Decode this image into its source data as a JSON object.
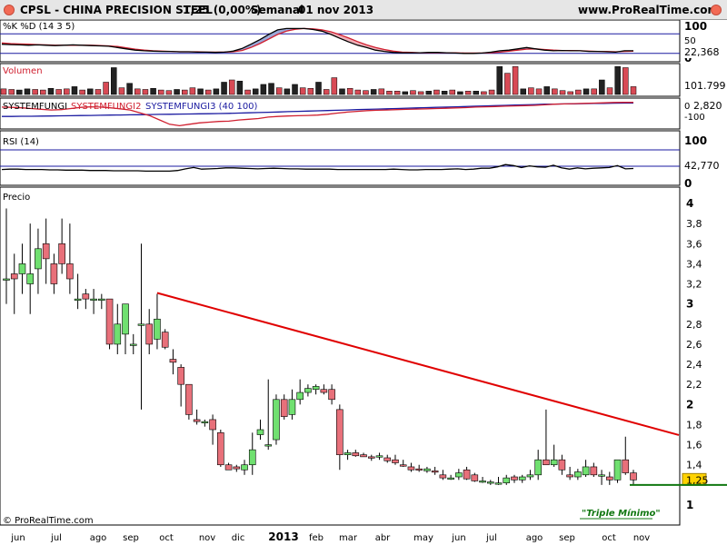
{
  "header": {
    "instrument": "CPSL - CHINA PRECISION STEEL",
    "last_quote": "1,25 (0,00%)",
    "period": "Semanal",
    "date": "01 nov 2013",
    "site": "www.ProRealTime.com"
  },
  "footer": {
    "copyright": "© ProRealTime.com"
  },
  "colors": {
    "red": "#e00000",
    "green": "#00aa00",
    "blue": "#1a1aa0",
    "bar_red": "#e8707a",
    "bar_green": "#70e070"
  },
  "chart_data": [
    {
      "type": "line",
      "title": "%K %D (14 3 5)",
      "ylim": [
        0,
        100
      ],
      "tick_labels": [
        "100",
        "50",
        "0"
      ],
      "last_value_label": "22,368",
      "series": [
        {
          "name": "%K",
          "values": [
            48,
            47,
            46,
            45,
            46,
            45,
            44,
            45,
            46,
            45,
            44,
            43,
            42,
            38,
            34,
            30,
            28,
            27,
            26,
            26,
            25,
            25,
            24,
            24,
            23,
            24,
            27,
            35,
            48,
            62,
            78,
            92,
            96,
            96,
            96,
            93,
            88,
            78,
            66,
            55,
            45,
            38,
            30,
            26,
            23,
            22,
            22,
            22,
            23,
            23,
            22,
            21,
            20,
            20,
            21,
            24,
            28,
            30,
            34,
            38,
            34,
            30,
            28,
            29,
            28,
            28,
            26,
            26,
            25,
            24,
            28,
            28
          ]
        },
        {
          "name": "%D",
          "values": [
            52,
            50,
            49,
            48,
            47,
            46,
            45,
            45,
            45,
            45,
            45,
            44,
            43,
            41,
            37,
            33,
            30,
            28,
            27,
            26,
            25,
            25,
            25,
            24,
            24,
            24,
            25,
            29,
            38,
            50,
            64,
            78,
            88,
            94,
            96,
            95,
            92,
            86,
            77,
            67,
            56,
            46,
            38,
            32,
            27,
            24,
            23,
            22,
            22,
            22,
            22,
            22,
            21,
            21,
            21,
            22,
            24,
            27,
            30,
            33,
            34,
            32,
            30,
            29,
            29,
            28,
            27,
            26,
            26,
            25,
            26,
            27
          ]
        }
      ]
    },
    {
      "type": "bar",
      "title": "Volumen",
      "last_value_label": "101.799",
      "values": [
        10,
        9,
        8,
        10,
        9,
        8,
        11,
        9,
        10,
        14,
        8,
        10,
        9,
        22,
        48,
        12,
        20,
        10,
        9,
        11,
        8,
        7,
        9,
        8,
        12,
        10,
        8,
        10,
        22,
        26,
        24,
        8,
        10,
        18,
        20,
        12,
        10,
        18,
        12,
        11,
        22,
        9,
        30,
        10,
        11,
        8,
        7,
        9,
        10,
        6,
        6,
        5,
        7,
        5,
        6,
        8,
        6,
        8,
        5,
        6,
        6,
        5,
        8,
        50,
        38,
        50,
        10,
        12,
        10,
        14,
        10,
        7,
        5,
        8,
        10,
        10,
        26,
        12,
        50,
        48,
        14
      ],
      "up": [
        false,
        false,
        true,
        true,
        false,
        false,
        true,
        false,
        false,
        true,
        false,
        true,
        false,
        false,
        true,
        false,
        true,
        false,
        false,
        true,
        false,
        false,
        true,
        false,
        false,
        true,
        false,
        true,
        true,
        false,
        true,
        false,
        true,
        true,
        true,
        false,
        true,
        true,
        false,
        false,
        true,
        false,
        false,
        true,
        false,
        false,
        false,
        true,
        false,
        false,
        false,
        true,
        false,
        false,
        true,
        false,
        true,
        false,
        true,
        false,
        true,
        false,
        false,
        true,
        false,
        false,
        true,
        false,
        false,
        true,
        false,
        false,
        false,
        false,
        true,
        false,
        true,
        false,
        true,
        false,
        false
      ]
    },
    {
      "type": "line",
      "title": "SYSTEMFUNGI SYSTEMFUNGI2 SYSTEMFUNGI3 (40 100)",
      "legend": [
        "SYSTEMFUNGI",
        "SYSTEMFUNGI2",
        "SYSTEMFUNGI3 (40 100)"
      ],
      "tick_labels": [
        "0",
        "-100"
      ],
      "last_value_label": "2,820",
      "series": [
        {
          "name": "SYSTEMFUNGI2",
          "values": [
            -30,
            -32,
            -35,
            -40,
            -45,
            -50,
            -48,
            -40,
            -32,
            -28,
            -30,
            -35,
            -42,
            -50,
            -70,
            -90,
            -120,
            -150,
            -160,
            -150,
            -140,
            -135,
            -130,
            -128,
            -120,
            -115,
            -110,
            -100,
            -95,
            -92,
            -90,
            -88,
            -86,
            -80,
            -72,
            -65,
            -60,
            -55,
            -52,
            -50,
            -48,
            -46,
            -44,
            -42,
            -40,
            -38,
            -36,
            -34,
            -30,
            -28,
            -26,
            -24,
            -22,
            -20,
            -18,
            -14,
            -10,
            -8,
            -6,
            -4,
            -2,
            0,
            2,
            3,
            3
          ]
        },
        {
          "name": "SYSTEMFUNGI3",
          "values": [
            -95,
            -95,
            -94,
            -94,
            -93,
            -92,
            -91,
            -90,
            -89,
            -88,
            -87,
            -86,
            -85,
            -84,
            -83,
            -82,
            -81,
            -80,
            -79,
            -78,
            -77,
            -76,
            -75,
            -74,
            -72,
            -70,
            -68,
            -66,
            -64,
            -62,
            -60,
            -58,
            -56,
            -54,
            -52,
            -50,
            -48,
            -46,
            -44,
            -42,
            -40,
            -38,
            -36,
            -34,
            -32,
            -30,
            -28,
            -26,
            -24,
            -22,
            -20,
            -18,
            -16,
            -14,
            -12,
            -10,
            -9,
            -8,
            -7,
            -6,
            -5,
            -4,
            -3,
            -2,
            -2
          ]
        }
      ]
    },
    {
      "type": "line",
      "title": "RSI (14)",
      "ylim": [
        0,
        100
      ],
      "tick_labels": [
        "100",
        "0"
      ],
      "last_value_label": "42,770",
      "series": [
        {
          "name": "RSI",
          "values": [
            40,
            41,
            41,
            40,
            40,
            40,
            39,
            39,
            38,
            38,
            38,
            37,
            37,
            37,
            36,
            36,
            36,
            36,
            35,
            35,
            35,
            35,
            37,
            42,
            46,
            41,
            42,
            43,
            45,
            45,
            44,
            43,
            42,
            43,
            44,
            43,
            42,
            42,
            41,
            41,
            41,
            41,
            40,
            40,
            40,
            40,
            40,
            40,
            40,
            41,
            40,
            39,
            39,
            40,
            40,
            40,
            41,
            42,
            40,
            41,
            44,
            44,
            48,
            55,
            52,
            46,
            51,
            48,
            47,
            53,
            45,
            41,
            45,
            42,
            44,
            45,
            46,
            52,
            42,
            43
          ]
        }
      ]
    },
    {
      "type": "candlestick",
      "title": "Precio",
      "ylim": [
        1,
        4
      ],
      "y_ticks": [
        4,
        3.8,
        3.6,
        3.4,
        3.2,
        3,
        2.8,
        2.6,
        2.4,
        2.2,
        2,
        1.8,
        1.6,
        1.4,
        1.25,
        1
      ],
      "y_tick_labels": [
        "4",
        "3,8",
        "3,6",
        "3,4",
        "3,2",
        "3",
        "2,8",
        "2,6",
        "2,4",
        "2,2",
        "2",
        "1,8",
        "1,6",
        "1,4",
        "1,25",
        "1"
      ],
      "bold_ticks": [
        "4",
        "3",
        "2",
        "1"
      ],
      "x_labels": [
        "jun",
        "jul",
        "ago",
        "sep",
        "oct",
        "nov",
        "dic",
        "2013",
        "feb",
        "mar",
        "abr",
        "may",
        "jun",
        "jul",
        "ago",
        "sep",
        "oct",
        "nov"
      ],
      "last_price_label": "1,25",
      "annotation": "\"Triple Mínimo\"",
      "trendline": {
        "from": [
          19,
          3.11
        ],
        "to": [
          92,
          1.54
        ]
      },
      "support_line": {
        "value": 1.2,
        "from": 79,
        "to": 89
      },
      "candles": [
        [
          3.25,
          3.95,
          3.0,
          3.25
        ],
        [
          3.3,
          3.5,
          2.9,
          3.25
        ],
        [
          3.3,
          3.6,
          3.1,
          3.4
        ],
        [
          3.2,
          3.8,
          2.9,
          3.3
        ],
        [
          3.35,
          3.75,
          3.1,
          3.55
        ],
        [
          3.6,
          3.85,
          3.2,
          3.45
        ],
        [
          3.4,
          3.5,
          3.1,
          3.2
        ],
        [
          3.6,
          3.85,
          3.3,
          3.4
        ],
        [
          3.4,
          3.8,
          3.1,
          3.25
        ],
        [
          3.05,
          3.3,
          2.95,
          3.05
        ],
        [
          3.1,
          3.15,
          2.95,
          3.05
        ],
        [
          3.05,
          3.15,
          2.9,
          3.05
        ],
        [
          3.05,
          3.1,
          2.95,
          3.05
        ],
        [
          3.05,
          3.05,
          2.55,
          2.6
        ],
        [
          2.6,
          3.0,
          2.5,
          2.8
        ],
        [
          2.7,
          3.0,
          2.5,
          3.0
        ],
        [
          2.6,
          2.7,
          2.5,
          2.6
        ],
        [
          2.8,
          3.6,
          1.95,
          2.8
        ],
        [
          2.8,
          2.95,
          2.5,
          2.6
        ],
        [
          2.65,
          3.1,
          2.55,
          2.85
        ],
        [
          2.72,
          2.75,
          2.55,
          2.57
        ],
        [
          2.45,
          2.55,
          2.3,
          2.42
        ],
        [
          2.37,
          2.4,
          1.98,
          2.2
        ],
        [
          2.2,
          2.2,
          1.85,
          1.9
        ],
        [
          1.85,
          1.95,
          1.8,
          1.83
        ],
        [
          1.83,
          1.85,
          1.78,
          1.83
        ],
        [
          1.85,
          1.9,
          1.6,
          1.75
        ],
        [
          1.72,
          1.75,
          1.38,
          1.4
        ],
        [
          1.4,
          1.42,
          1.35,
          1.35
        ],
        [
          1.38,
          1.4,
          1.33,
          1.36
        ],
        [
          1.35,
          1.45,
          1.3,
          1.4
        ],
        [
          1.4,
          1.72,
          1.3,
          1.55
        ],
        [
          1.7,
          1.85,
          1.65,
          1.75
        ],
        [
          1.6,
          2.25,
          1.55,
          1.6
        ],
        [
          1.65,
          2.1,
          1.6,
          2.05
        ],
        [
          2.05,
          2.1,
          1.85,
          1.88
        ],
        [
          1.9,
          2.15,
          1.85,
          2.05
        ],
        [
          2.05,
          2.25,
          2.0,
          2.12
        ],
        [
          2.12,
          2.2,
          2.08,
          2.16
        ],
        [
          2.15,
          2.2,
          2.1,
          2.18
        ],
        [
          2.15,
          2.2,
          2.1,
          2.12
        ],
        [
          2.15,
          2.2,
          2.0,
          2.05
        ],
        [
          1.95,
          2.0,
          1.35,
          1.5
        ],
        [
          1.5,
          1.55,
          1.45,
          1.52
        ],
        [
          1.52,
          1.55,
          1.48,
          1.49
        ],
        [
          1.5,
          1.52,
          1.48,
          1.48
        ],
        [
          1.48,
          1.5,
          1.44,
          1.47
        ],
        [
          1.48,
          1.52,
          1.45,
          1.49
        ],
        [
          1.47,
          1.5,
          1.42,
          1.44
        ],
        [
          1.45,
          1.5,
          1.4,
          1.42
        ],
        [
          1.4,
          1.45,
          1.38,
          1.39
        ],
        [
          1.38,
          1.42,
          1.33,
          1.35
        ],
        [
          1.36,
          1.4,
          1.33,
          1.35
        ],
        [
          1.34,
          1.38,
          1.32,
          1.36
        ],
        [
          1.34,
          1.38,
          1.3,
          1.33
        ],
        [
          1.3,
          1.35,
          1.25,
          1.27
        ],
        [
          1.27,
          1.3,
          1.25,
          1.27
        ],
        [
          1.28,
          1.36,
          1.25,
          1.32
        ],
        [
          1.35,
          1.38,
          1.25,
          1.26
        ],
        [
          1.3,
          1.32,
          1.23,
          1.24
        ],
        [
          1.24,
          1.28,
          1.22,
          1.24
        ],
        [
          1.22,
          1.25,
          1.2,
          1.23
        ],
        [
          1.22,
          1.28,
          1.2,
          1.22
        ],
        [
          1.22,
          1.3,
          1.2,
          1.27
        ],
        [
          1.28,
          1.3,
          1.22,
          1.25
        ],
        [
          1.25,
          1.3,
          1.22,
          1.28
        ],
        [
          1.28,
          1.35,
          1.25,
          1.3
        ],
        [
          1.3,
          1.55,
          1.25,
          1.45
        ],
        [
          1.45,
          1.95,
          1.4,
          1.4
        ],
        [
          1.4,
          1.6,
          1.38,
          1.45
        ],
        [
          1.45,
          1.5,
          1.3,
          1.35
        ],
        [
          1.3,
          1.38,
          1.25,
          1.28
        ],
        [
          1.28,
          1.36,
          1.25,
          1.33
        ],
        [
          1.3,
          1.45,
          1.28,
          1.38
        ],
        [
          1.38,
          1.42,
          1.28,
          1.3
        ],
        [
          1.3,
          1.35,
          1.2,
          1.3
        ],
        [
          1.28,
          1.33,
          1.2,
          1.25
        ],
        [
          1.25,
          1.45,
          1.22,
          1.45
        ],
        [
          1.45,
          1.68,
          1.3,
          1.32
        ],
        [
          1.32,
          1.35,
          1.2,
          1.25
        ]
      ]
    }
  ]
}
